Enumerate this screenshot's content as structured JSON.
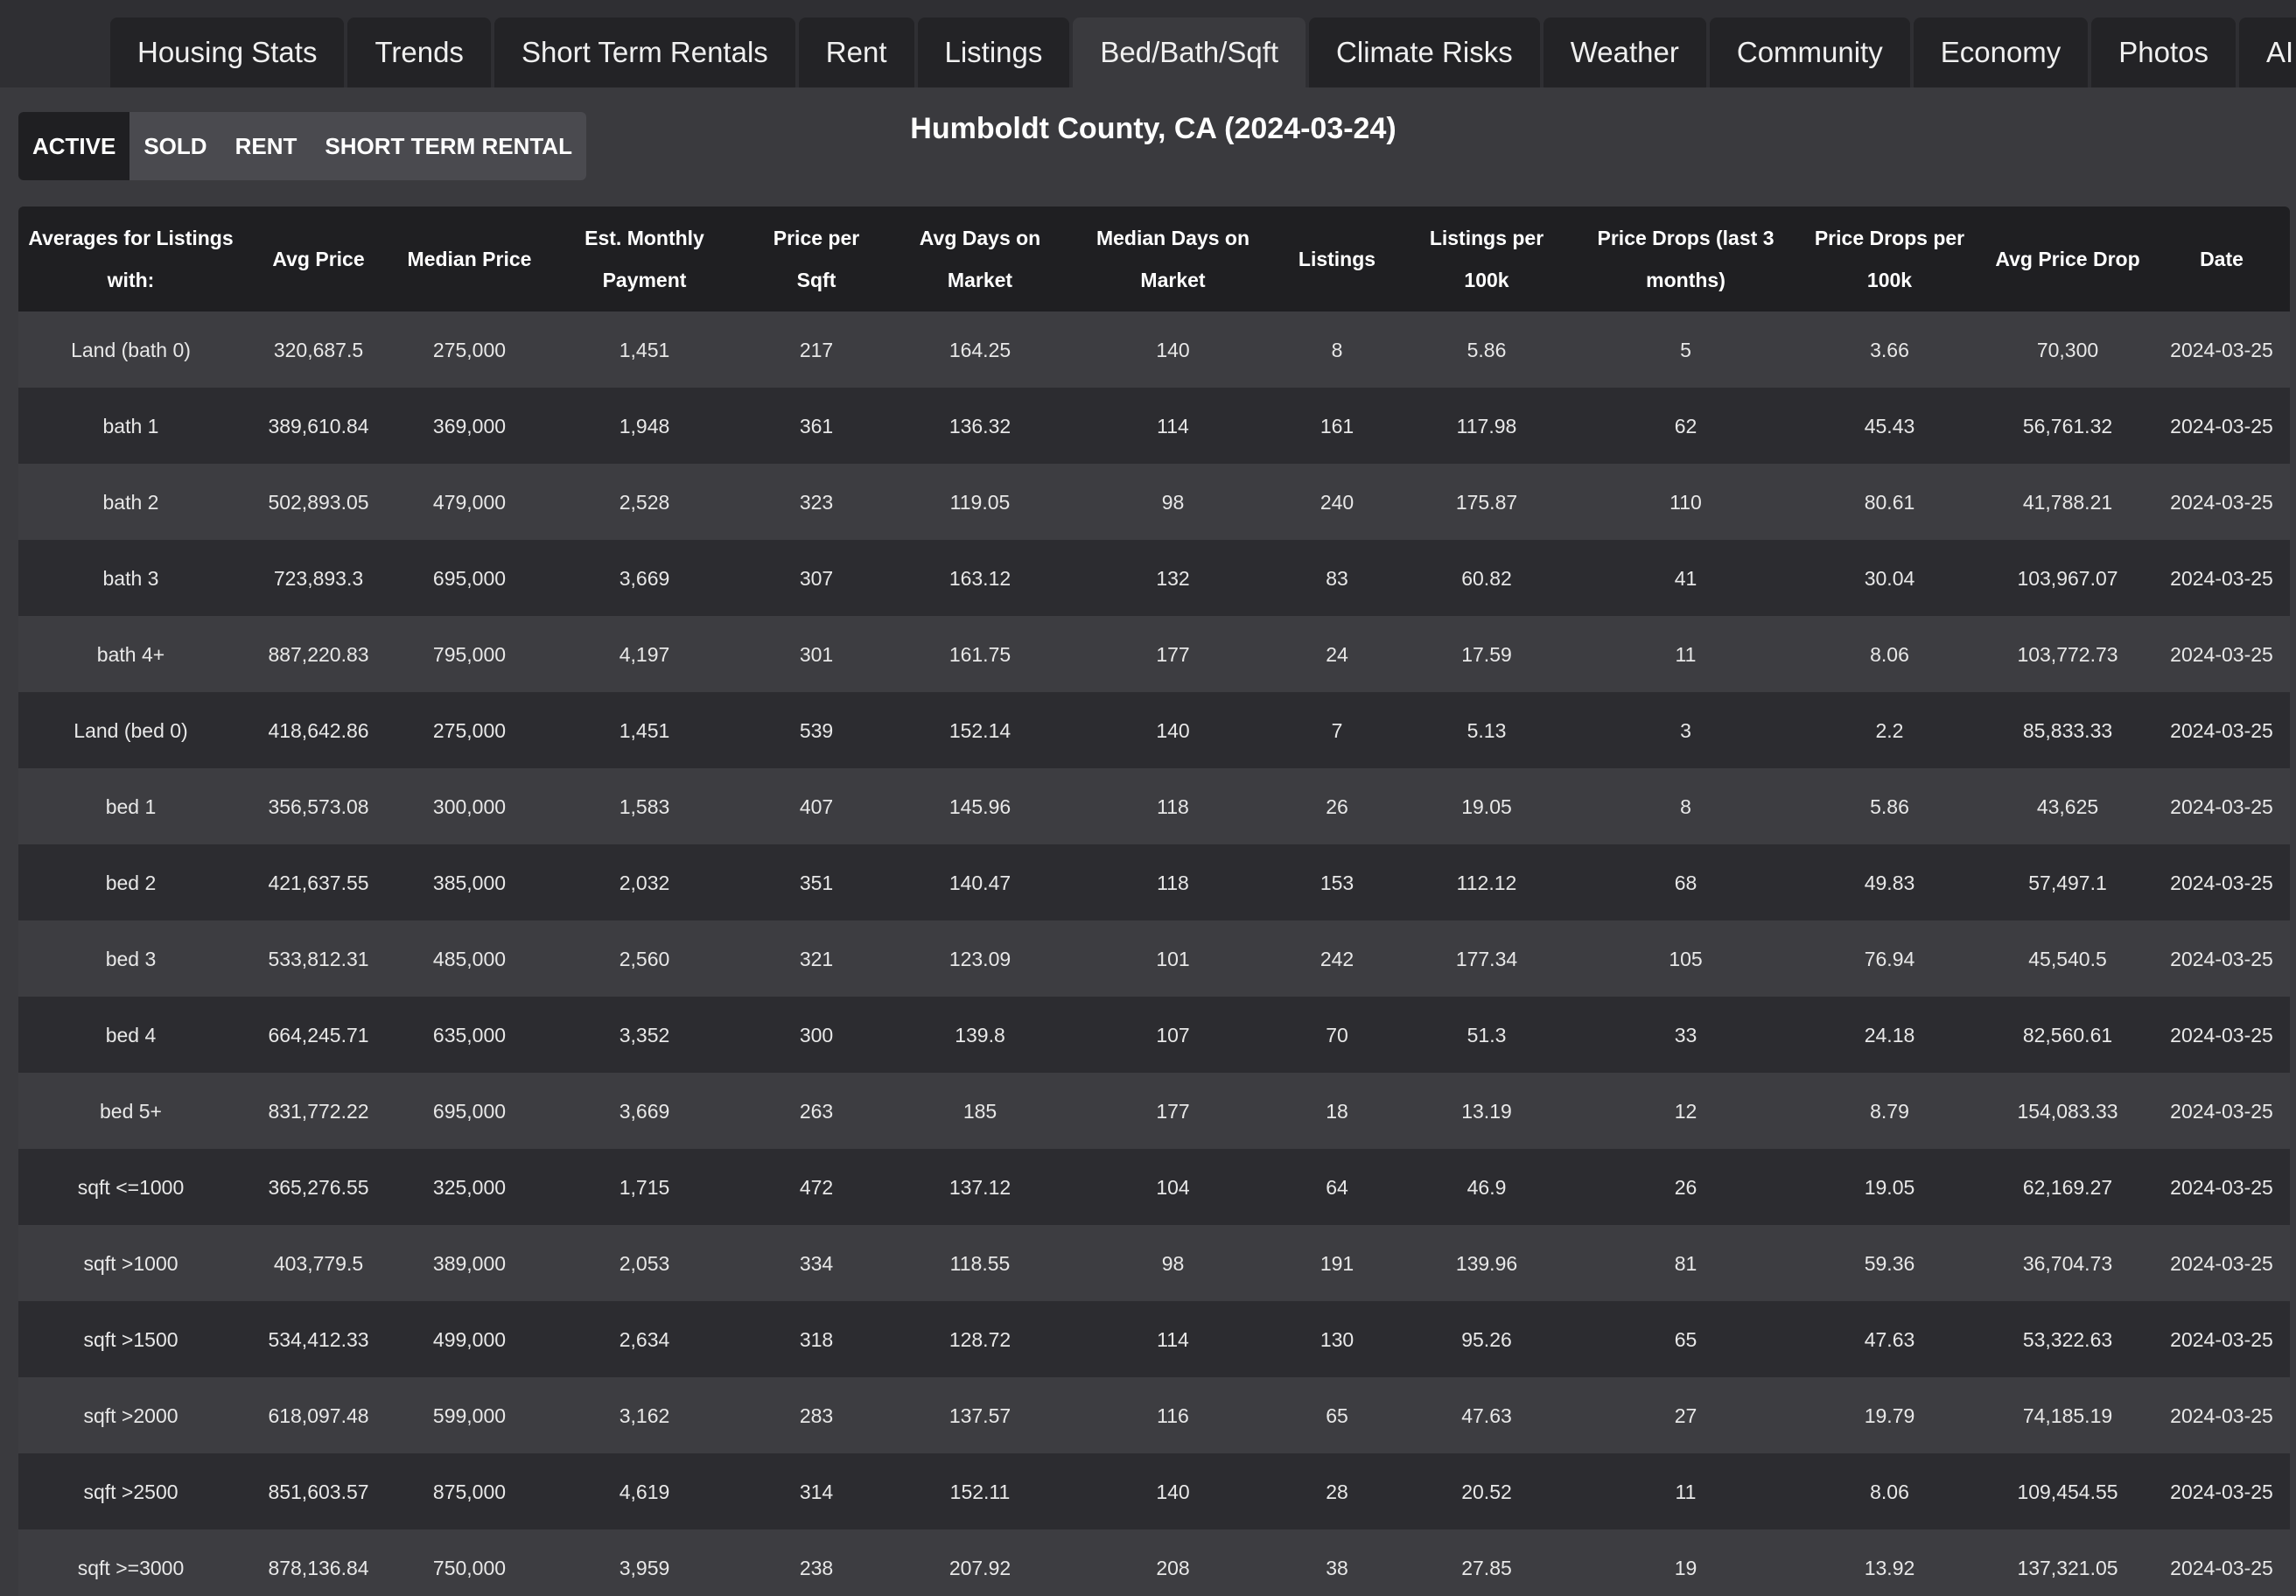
{
  "nav": {
    "tabs": [
      {
        "label": "Housing Stats",
        "name": "tab-housing-stats"
      },
      {
        "label": "Trends",
        "name": "tab-trends"
      },
      {
        "label": "Short Term Rentals",
        "name": "tab-short-term-rentals"
      },
      {
        "label": "Rent",
        "name": "tab-rent"
      },
      {
        "label": "Listings",
        "name": "tab-listings"
      },
      {
        "label": "Bed/Bath/Sqft",
        "name": "tab-bed-bath-sqft",
        "active": true
      },
      {
        "label": "Climate Risks",
        "name": "tab-climate-risks"
      },
      {
        "label": "Weather",
        "name": "tab-weather"
      },
      {
        "label": "Community",
        "name": "tab-community"
      },
      {
        "label": "Economy",
        "name": "tab-economy"
      },
      {
        "label": "Photos",
        "name": "tab-photos"
      },
      {
        "label": "AI",
        "name": "tab-ai"
      }
    ]
  },
  "subtabs": [
    {
      "label": "ACTIVE",
      "name": "subtab-active",
      "active": true
    },
    {
      "label": "SOLD",
      "name": "subtab-sold"
    },
    {
      "label": "RENT",
      "name": "subtab-rent"
    },
    {
      "label": "SHORT TERM RENTAL",
      "name": "subtab-short-term-rental"
    }
  ],
  "title": "Humboldt County, CA (2024-03-24)",
  "table": {
    "columns": [
      "Averages for Listings with:",
      "Avg Price",
      "Median Price",
      "Est. Monthly Payment",
      "Price per Sqft",
      "Avg Days on Market",
      "Median Days on Market",
      "Listings",
      "Listings per 100k",
      "Price Drops (last 3 months)",
      "Price Drops per 100k",
      "Avg Price Drop",
      "Date"
    ],
    "rows": [
      [
        "Land (bath 0)",
        "320,687.5",
        "275,000",
        "1,451",
        "217",
        "164.25",
        "140",
        "8",
        "5.86",
        "5",
        "3.66",
        "70,300",
        "2024-03-25"
      ],
      [
        "bath 1",
        "389,610.84",
        "369,000",
        "1,948",
        "361",
        "136.32",
        "114",
        "161",
        "117.98",
        "62",
        "45.43",
        "56,761.32",
        "2024-03-25"
      ],
      [
        "bath 2",
        "502,893.05",
        "479,000",
        "2,528",
        "323",
        "119.05",
        "98",
        "240",
        "175.87",
        "110",
        "80.61",
        "41,788.21",
        "2024-03-25"
      ],
      [
        "bath 3",
        "723,893.3",
        "695,000",
        "3,669",
        "307",
        "163.12",
        "132",
        "83",
        "60.82",
        "41",
        "30.04",
        "103,967.07",
        "2024-03-25"
      ],
      [
        "bath 4+",
        "887,220.83",
        "795,000",
        "4,197",
        "301",
        "161.75",
        "177",
        "24",
        "17.59",
        "11",
        "8.06",
        "103,772.73",
        "2024-03-25"
      ],
      [
        "Land (bed 0)",
        "418,642.86",
        "275,000",
        "1,451",
        "539",
        "152.14",
        "140",
        "7",
        "5.13",
        "3",
        "2.2",
        "85,833.33",
        "2024-03-25"
      ],
      [
        "bed 1",
        "356,573.08",
        "300,000",
        "1,583",
        "407",
        "145.96",
        "118",
        "26",
        "19.05",
        "8",
        "5.86",
        "43,625",
        "2024-03-25"
      ],
      [
        "bed 2",
        "421,637.55",
        "385,000",
        "2,032",
        "351",
        "140.47",
        "118",
        "153",
        "112.12",
        "68",
        "49.83",
        "57,497.1",
        "2024-03-25"
      ],
      [
        "bed 3",
        "533,812.31",
        "485,000",
        "2,560",
        "321",
        "123.09",
        "101",
        "242",
        "177.34",
        "105",
        "76.94",
        "45,540.5",
        "2024-03-25"
      ],
      [
        "bed 4",
        "664,245.71",
        "635,000",
        "3,352",
        "300",
        "139.8",
        "107",
        "70",
        "51.3",
        "33",
        "24.18",
        "82,560.61",
        "2024-03-25"
      ],
      [
        "bed 5+",
        "831,772.22",
        "695,000",
        "3,669",
        "263",
        "185",
        "177",
        "18",
        "13.19",
        "12",
        "8.79",
        "154,083.33",
        "2024-03-25"
      ],
      [
        "sqft <=1000",
        "365,276.55",
        "325,000",
        "1,715",
        "472",
        "137.12",
        "104",
        "64",
        "46.9",
        "26",
        "19.05",
        "62,169.27",
        "2024-03-25"
      ],
      [
        "sqft >1000",
        "403,779.5",
        "389,000",
        "2,053",
        "334",
        "118.55",
        "98",
        "191",
        "139.96",
        "81",
        "59.36",
        "36,704.73",
        "2024-03-25"
      ],
      [
        "sqft >1500",
        "534,412.33",
        "499,000",
        "2,634",
        "318",
        "128.72",
        "114",
        "130",
        "95.26",
        "65",
        "47.63",
        "53,322.63",
        "2024-03-25"
      ],
      [
        "sqft >2000",
        "618,097.48",
        "599,000",
        "3,162",
        "283",
        "137.57",
        "116",
        "65",
        "47.63",
        "27",
        "19.79",
        "74,185.19",
        "2024-03-25"
      ],
      [
        "sqft >2500",
        "851,603.57",
        "875,000",
        "4,619",
        "314",
        "152.11",
        "140",
        "28",
        "20.52",
        "11",
        "8.06",
        "109,454.55",
        "2024-03-25"
      ],
      [
        "sqft >=3000",
        "878,136.84",
        "750,000",
        "3,959",
        "238",
        "207.92",
        "208",
        "38",
        "27.85",
        "19",
        "13.92",
        "137,321.05",
        "2024-03-25"
      ]
    ]
  }
}
